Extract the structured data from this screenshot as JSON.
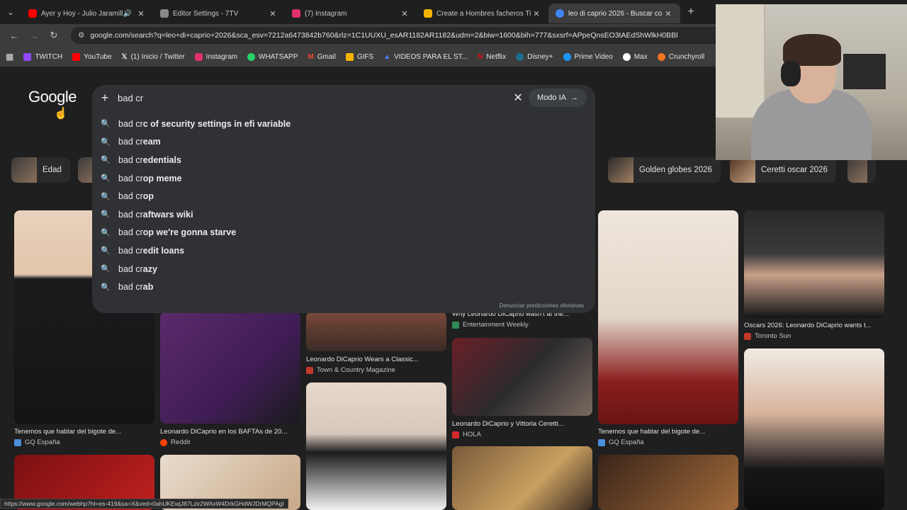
{
  "tabs": [
    {
      "title": "Ayer y Hoy - Julio Jaramill",
      "color": "#ff0000",
      "active": false
    },
    {
      "title": "Editor Settings - 7TV",
      "color": "#e3e3e3",
      "active": false
    },
    {
      "title": "(7) Instagram",
      "color": "#e1306c",
      "active": false
    },
    {
      "title": "Create a Hombres facheros Ti",
      "color": "#f4b400",
      "active": false
    },
    {
      "title": "leo di caprio 2026 - Buscar co",
      "color": "#4285f4",
      "active": true
    }
  ],
  "address": {
    "url": "google.com/search?q=leo+di+caprio+2026&sca_esv=7212a6473842b760&rlz=1C1UUXU_esAR1182AR1182&udm=2&biw=1600&bih=777&sxsrf=APpeQnsEO3tAEdShWlkH0BBl"
  },
  "bookmarks": [
    {
      "label": "TWITCH",
      "color": "#9146ff"
    },
    {
      "label": "YouTube",
      "color": "#ff0000"
    },
    {
      "label": "(1) Inicio / Twitter",
      "color": "#ffffff"
    },
    {
      "label": "Instagram",
      "color": "#e1306c"
    },
    {
      "label": "WHATSAPP",
      "color": "#25d366"
    },
    {
      "label": "Gmail",
      "color": "#ea4335"
    },
    {
      "label": "GIFS",
      "color": "#f4b400"
    },
    {
      "label": "VIDEOS PARA EL ST...",
      "color": "#4285f4"
    },
    {
      "label": "Netflix",
      "color": "#e50914"
    },
    {
      "label": "Disney+",
      "color": "#1b6f8a"
    },
    {
      "label": "Prime Video",
      "color": "#1a98ff"
    },
    {
      "label": "Max",
      "color": "#ffffff"
    },
    {
      "label": "Crunchyroll",
      "color": "#f47521"
    }
  ],
  "google": {
    "logo": "Google"
  },
  "search": {
    "query": "bad cr",
    "ai_mode": "Modo IA"
  },
  "suggestions": [
    {
      "prefix": "bad cr",
      "rest": "c of security settings in efi variable"
    },
    {
      "prefix": "bad cr",
      "rest": "eam"
    },
    {
      "prefix": "bad cr",
      "rest": "edentials"
    },
    {
      "prefix": "bad cr",
      "rest": "op meme"
    },
    {
      "prefix": "bad cr",
      "rest": "op"
    },
    {
      "prefix": "bad cr",
      "rest": "aftwars wiki"
    },
    {
      "prefix": "bad cr",
      "rest": "op we're gonna starve"
    },
    {
      "prefix": "bad cr",
      "rest": "edit loans"
    },
    {
      "prefix": "bad cr",
      "rest": "azy"
    },
    {
      "prefix": "bad cr",
      "rest": "ab"
    }
  ],
  "report_link": "Denunciar predicciones ofensivas",
  "chips": [
    {
      "label": "Edad"
    },
    {
      "label": "Golden globes 2026"
    },
    {
      "label": "Ceretti oscar 2026"
    }
  ],
  "results": [
    {
      "caption": "Tenemos que hablar del bigote de...",
      "source": "GQ España",
      "src_color": "#4a90d9"
    },
    {
      "caption": "Leonardo DiCaprio en los BAFTAs de 20...",
      "source": "Reddit",
      "src_color": "#ff4500"
    },
    {
      "caption": "Leonardo DiCaprio Wears a Classic...",
      "source": "Town & Country Magazine",
      "src_color": "#c0392b"
    },
    {
      "caption": "Why Leonardo DiCaprio wasn't at the...",
      "source": "Entertainment Weekly",
      "src_color": "#2e8b57"
    },
    {
      "caption": "Leonardo DiCaprio y Vittoria Ceretti...",
      "source": "HOLA",
      "src_color": "#d62828"
    },
    {
      "caption": "Tenemos que hablar del bigote de...",
      "source": "GQ España",
      "src_color": "#4a90d9"
    },
    {
      "caption": "Oscars 2026: Leonardo DiCaprio wants t...",
      "source": "Toronto Sun",
      "src_color": "#c0392b"
    }
  ],
  "status_url": "https://www.google.com/webhp?hl=es-419&sa=X&ved=0ahUKEwjJ87Lzir2WAxW4DrkGHdWJDrMQPAgI"
}
